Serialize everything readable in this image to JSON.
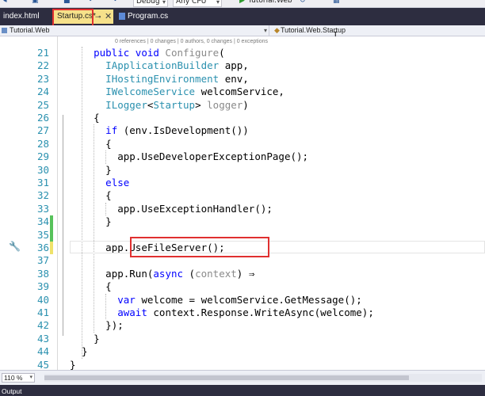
{
  "toolbar": {
    "config": "Debug",
    "platform": "Any CPU",
    "run_target": "Tutorial.Web"
  },
  "tabs": [
    {
      "label": "index.html",
      "type": "html"
    },
    {
      "label": "Startup.cs*",
      "type": "cs",
      "active": true,
      "pin": "⊸",
      "close": "✕"
    },
    {
      "label": "Program.cs",
      "type": "cs"
    }
  ],
  "navbar": {
    "project": "Tutorial.Web",
    "scope": "Tutorial.Web.Startup"
  },
  "codelens": "0 references | 0 changes | 0 authors, 0 changes | 0 exceptions",
  "editor": {
    "line_numbers": [
      "21",
      "22",
      "23",
      "24",
      "25",
      "26",
      "27",
      "28",
      "29",
      "30",
      "31",
      "32",
      "33",
      "34",
      "35",
      "36",
      "37",
      "38",
      "39",
      "40",
      "41",
      "42",
      "43",
      "44",
      "45"
    ],
    "lines": [
      [
        {
          "t": "public void ",
          "c": "kw"
        },
        {
          "t": "Configure",
          "c": "gr"
        },
        {
          "t": "(",
          "c": ""
        }
      ],
      [
        {
          "t": "IApplicationBuilder",
          "c": "ty"
        },
        {
          "t": " app,",
          "c": ""
        }
      ],
      [
        {
          "t": "IHostingEnvironment",
          "c": "ty"
        },
        {
          "t": " env,",
          "c": ""
        }
      ],
      [
        {
          "t": "IWelcomeService",
          "c": "ty"
        },
        {
          "t": " welcomService,",
          "c": ""
        }
      ],
      [
        {
          "t": "ILogger",
          "c": "ty"
        },
        {
          "t": "<",
          "c": ""
        },
        {
          "t": "Startup",
          "c": "ty"
        },
        {
          "t": "> ",
          "c": ""
        },
        {
          "t": "logger",
          "c": "gr"
        },
        {
          "t": ")",
          "c": ""
        }
      ],
      [
        {
          "t": "{",
          "c": ""
        }
      ],
      [
        {
          "t": "if",
          "c": "kw"
        },
        {
          "t": " (env.IsDevelopment())",
          "c": ""
        }
      ],
      [
        {
          "t": "{",
          "c": ""
        }
      ],
      [
        {
          "t": "app.UseDeveloperExceptionPage();",
          "c": ""
        }
      ],
      [
        {
          "t": "}",
          "c": ""
        }
      ],
      [
        {
          "t": "else",
          "c": "kw"
        }
      ],
      [
        {
          "t": "{",
          "c": ""
        }
      ],
      [
        {
          "t": "app.UseExceptionHandler();",
          "c": ""
        }
      ],
      [
        {
          "t": "}",
          "c": ""
        }
      ],
      [],
      [
        {
          "t": "app.UseFileServer();",
          "c": ""
        }
      ],
      [],
      [
        {
          "t": "app.Run(",
          "c": ""
        },
        {
          "t": "async",
          "c": "kw"
        },
        {
          "t": " (",
          "c": ""
        },
        {
          "t": "context",
          "c": "gr"
        },
        {
          "t": ") ⇒",
          "c": ""
        }
      ],
      [
        {
          "t": "{",
          "c": ""
        }
      ],
      [
        {
          "t": "var",
          "c": "kw"
        },
        {
          "t": " welcome = welcomService.GetMessage();",
          "c": ""
        }
      ],
      [
        {
          "t": "await",
          "c": "kw"
        },
        {
          "t": " context.Response.WriteAsync(welcome);",
          "c": ""
        }
      ],
      [
        {
          "t": "});",
          "c": ""
        }
      ],
      [
        {
          "t": "}",
          "c": ""
        }
      ],
      [
        {
          "t": "}",
          "c": ""
        }
      ],
      [
        {
          "t": "}",
          "c": ""
        }
      ]
    ]
  },
  "status": {
    "zoom": "110 %"
  },
  "output_panel": {
    "title": "Output"
  }
}
